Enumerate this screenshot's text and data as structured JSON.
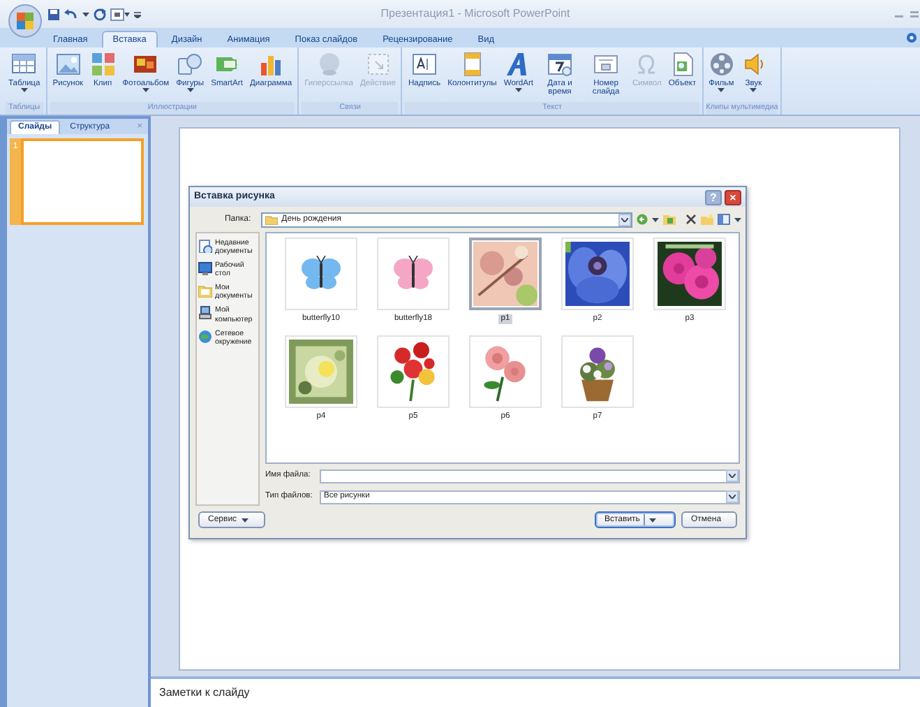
{
  "window": {
    "title": "Презентация1 - Microsoft PowerPoint"
  },
  "ribbon": {
    "tabs": [
      {
        "label": "Главная",
        "selected": false
      },
      {
        "label": "Вставка",
        "selected": true
      },
      {
        "label": "Дизайн",
        "selected": false
      },
      {
        "label": "Анимация",
        "selected": false
      },
      {
        "label": "Показ слайдов",
        "selected": false
      },
      {
        "label": "Рецензирование",
        "selected": false
      },
      {
        "label": "Вид",
        "selected": false
      }
    ],
    "groups": [
      {
        "label": "Таблицы",
        "buttons": [
          {
            "label": "Таблица",
            "dropdown": true,
            "disabled": false
          }
        ]
      },
      {
        "label": "Иллюстрации",
        "buttons": [
          {
            "label": "Рисунок",
            "dropdown": false,
            "disabled": false
          },
          {
            "label": "Клип",
            "dropdown": false,
            "disabled": false
          },
          {
            "label": "Фотоальбом",
            "dropdown": true,
            "disabled": false
          },
          {
            "label": "Фигуры",
            "dropdown": true,
            "disabled": false
          },
          {
            "label": "SmartArt",
            "dropdown": false,
            "disabled": false
          },
          {
            "label": "Диаграмма",
            "dropdown": false,
            "disabled": false
          }
        ]
      },
      {
        "label": "Связи",
        "buttons": [
          {
            "label": "Гиперссылка",
            "dropdown": false,
            "disabled": true
          },
          {
            "label": "Действие",
            "dropdown": false,
            "disabled": true
          }
        ]
      },
      {
        "label": "Текст",
        "buttons": [
          {
            "label": "Надпись",
            "dropdown": false,
            "disabled": false
          },
          {
            "label": "Колонтитулы",
            "dropdown": false,
            "disabled": false
          },
          {
            "label": "WordArt",
            "dropdown": true,
            "disabled": false
          },
          {
            "label": "Дата и время",
            "dropdown": false,
            "disabled": false
          },
          {
            "label": "Номер слайда",
            "dropdown": false,
            "disabled": false
          },
          {
            "label": "Символ",
            "dropdown": false,
            "disabled": true
          },
          {
            "label": "Объект",
            "dropdown": false,
            "disabled": false
          }
        ]
      },
      {
        "label": "Клипы мультимедиа",
        "buttons": [
          {
            "label": "Фильм",
            "dropdown": true,
            "disabled": false
          },
          {
            "label": "Звук",
            "dropdown": true,
            "disabled": false
          }
        ]
      }
    ]
  },
  "slides_pane": {
    "tabs": [
      {
        "label": "Слайды",
        "selected": true
      },
      {
        "label": "Структура",
        "selected": false
      }
    ],
    "close": "×",
    "slides": [
      {
        "number": "1",
        "selected": true
      }
    ]
  },
  "notes": {
    "text": "Заметки к слайду"
  },
  "dialog": {
    "title": "Вставка рисунка",
    "help": "?",
    "close": "×",
    "folder_label": "Папка:",
    "folder": "День рождения",
    "places": [
      {
        "label": "Недавние документы"
      },
      {
        "label": "Рабочий стол"
      },
      {
        "label": "Мои документы"
      },
      {
        "label": "Мой компьютер"
      },
      {
        "label": "Сетевое окружение"
      }
    ],
    "files": [
      {
        "name": "butterfly10",
        "kind": "butterfly",
        "color": "#74b8f0",
        "selected": false
      },
      {
        "name": "butterfly18",
        "kind": "butterfly",
        "color": "#f4a6c4",
        "selected": false
      },
      {
        "name": "p1",
        "kind": "picture",
        "selected": true
      },
      {
        "name": "p2",
        "kind": "picture",
        "selected": false
      },
      {
        "name": "p3",
        "kind": "picture",
        "selected": false
      },
      {
        "name": "p4",
        "kind": "picture",
        "selected": false
      },
      {
        "name": "p5",
        "kind": "picture",
        "selected": false
      },
      {
        "name": "p6",
        "kind": "picture",
        "selected": false
      },
      {
        "name": "p7",
        "kind": "picture",
        "selected": false
      }
    ],
    "file_name_label": "Имя файла:",
    "file_type_label": "Тип файлов:",
    "file_type": "Все рисунки",
    "buttons": [
      {
        "label": "Сервис",
        "dropdown": true,
        "default": false
      },
      {
        "label": "Вставить",
        "dropdown": true,
        "default": true
      },
      {
        "label": "Отмена",
        "dropdown": false,
        "default": false
      }
    ]
  }
}
